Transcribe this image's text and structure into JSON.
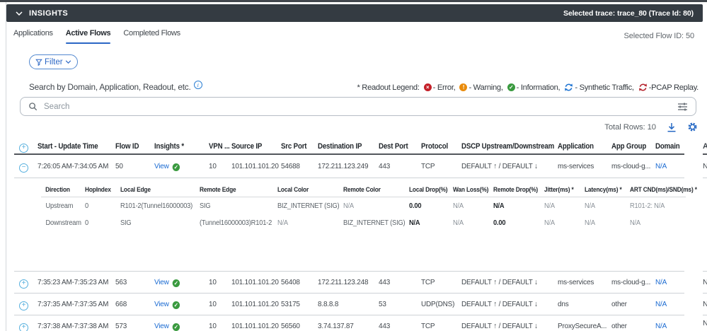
{
  "header": {
    "title": "INSIGHTS",
    "selected_trace": "Selected trace: trace_80 (Trace Id: 80)"
  },
  "tabs": [
    {
      "label": "Applications",
      "active": false
    },
    {
      "label": "Active Flows",
      "active": true
    },
    {
      "label": "Completed Flows",
      "active": false
    }
  ],
  "toolbar": {
    "selected_flow": "Selected Flow ID: 50",
    "filter_label": "Filter",
    "search_label": "Search by Domain, Application, Readout, etc.",
    "search_placeholder": "Search",
    "total_rows": "Total Rows: 10"
  },
  "legend": {
    "prefix": "* Readout Legend:",
    "items": [
      {
        "icon": "error-icon",
        "label": "- Error,"
      },
      {
        "icon": "warning-icon",
        "label": "- Warning,"
      },
      {
        "icon": "information-icon",
        "label": "- Information,"
      },
      {
        "icon": "synthetic-traffic-icon",
        "label": "- Synthetic Traffic,"
      },
      {
        "icon": "pcap-replay-icon",
        "label": "-PCAP Replay."
      }
    ]
  },
  "flows_table": {
    "headers": [
      "Start - Update Time",
      "Flow ID",
      "Insights *",
      "VPN ...",
      "Source IP",
      "Src Port",
      "Destination IP",
      "Dest Port",
      "Protocol",
      "DSCP Upstream/Downstream",
      "Application",
      "App Group",
      "Domain"
    ],
    "overflow_header_fragment": "A",
    "overflow_cell_fragment": "N",
    "rows": [
      {
        "expanded": true,
        "time": "7:26:05 AM-7:34:05 AM",
        "flow_id": "50",
        "insights": "View",
        "vpn": "10",
        "source_ip": "101.101.101.20",
        "src_port": "54688",
        "dest_ip": "172.211.123.249",
        "dest_port": "443",
        "protocol": "TCP",
        "dscp": "DEFAULT ↑ / DEFAULT ↓",
        "application": "ms-services",
        "app_group": "ms-cloud-g...",
        "domain": "N/A"
      },
      {
        "expanded": false,
        "time": "7:35:23 AM-7:35:23 AM",
        "flow_id": "563",
        "insights": "View",
        "vpn": "10",
        "source_ip": "101.101.101.20",
        "src_port": "56408",
        "dest_ip": "172.211.123.248",
        "dest_port": "443",
        "protocol": "TCP",
        "dscp": "DEFAULT ↑ / DEFAULT ↓",
        "application": "ms-services",
        "app_group": "ms-cloud-g...",
        "domain": "N/A"
      },
      {
        "expanded": false,
        "time": "7:37:35 AM-7:37:35 AM",
        "flow_id": "668",
        "insights": "View",
        "vpn": "10",
        "source_ip": "101.101.101.20",
        "src_port": "53175",
        "dest_ip": "8.8.8.8",
        "dest_port": "53",
        "protocol": "UDP(DNS)",
        "dscp": "DEFAULT ↑ / DEFAULT ↓",
        "application": "dns",
        "app_group": "other",
        "domain": "N/A"
      },
      {
        "expanded": false,
        "time": "7:37:38 AM-7:37:38 AM",
        "flow_id": "573",
        "insights": "View",
        "vpn": "10",
        "source_ip": "101.101.101.20",
        "src_port": "56560",
        "dest_ip": "3.74.137.87",
        "dest_port": "443",
        "protocol": "TCP",
        "dscp": "DEFAULT ↑ / DEFAULT ↓",
        "application": "ProxySecureA...",
        "app_group": "other",
        "domain": "N/A"
      }
    ]
  },
  "hops_table": {
    "headers": [
      "Direction",
      "HopIndex",
      "Local Edge",
      "Remote Edge",
      "Local Color",
      "Remote Color",
      "Local Drop(%)",
      "Wan Loss(%)",
      "Remote Drop(%)",
      "Jitter(ms) *",
      "Latency(ms) *",
      "ART CND(ms)/SND(ms) *"
    ],
    "rows": [
      {
        "direction": "Upstream",
        "hop_index": "0",
        "local_edge": "R101-2(Tunnel16000003)",
        "remote_edge": "SIG",
        "local_color": "BIZ_INTERNET (SIG)",
        "remote_color": "N/A",
        "local_drop": "0.00",
        "wan_loss": "N/A",
        "remote_drop": "N/A",
        "jitter": "N/A",
        "latency": "N/A",
        "art": "R101-2: N/A"
      },
      {
        "direction": "Downstream",
        "hop_index": "0",
        "local_edge": "SIG",
        "remote_edge": "(Tunnel16000003)R101-2",
        "local_color": "N/A",
        "remote_color": "BIZ_INTERNET (SIG)",
        "local_drop": "N/A",
        "wan_loss": "N/A",
        "remote_drop": "0.00",
        "jitter": "N/A",
        "latency": "N/A",
        "art": "N/A"
      }
    ]
  }
}
